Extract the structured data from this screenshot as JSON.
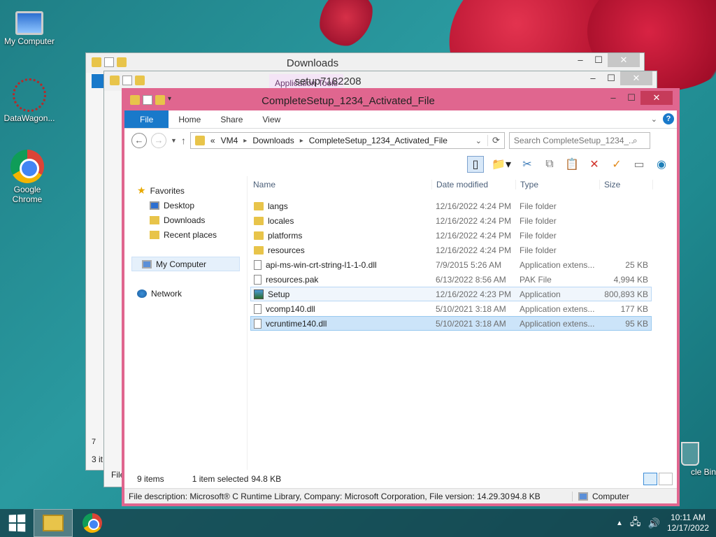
{
  "desktop": {
    "icons": [
      {
        "label": "My Computer"
      },
      {
        "label": "DataWagon..."
      },
      {
        "label": "Google Chrome"
      },
      {
        "label": "cle Bin"
      }
    ]
  },
  "back_windows": [
    {
      "title": "Downloads",
      "status_count": "3 it",
      "status_fragment": "7",
      "footer": "File"
    },
    {
      "title": "setup7182208",
      "context_tab": "Application Tools"
    }
  ],
  "window": {
    "title": "CompleteSetup_1234_Activated_File",
    "ribbon_tabs": {
      "file": "File",
      "home": "Home",
      "share": "Share",
      "view": "View"
    },
    "address": {
      "prefix": "«",
      "segments": [
        "VM4",
        "Downloads",
        "CompleteSetup_1234_Activated_File"
      ]
    },
    "search_placeholder": "Search CompleteSetup_1234_...",
    "nav": {
      "favorites": "Favorites",
      "desktop": "Desktop",
      "downloads": "Downloads",
      "recent": "Recent places",
      "my_computer": "My Computer",
      "network": "Network"
    },
    "columns": {
      "name": "Name",
      "date": "Date modified",
      "type": "Type",
      "size": "Size"
    },
    "files": [
      {
        "name": "langs",
        "date": "12/16/2022 4:24 PM",
        "type": "File folder",
        "size": ""
      },
      {
        "name": "locales",
        "date": "12/16/2022 4:24 PM",
        "type": "File folder",
        "size": ""
      },
      {
        "name": "platforms",
        "date": "12/16/2022 4:24 PM",
        "type": "File folder",
        "size": ""
      },
      {
        "name": "resources",
        "date": "12/16/2022 4:24 PM",
        "type": "File folder",
        "size": ""
      },
      {
        "name": "api-ms-win-crt-string-l1-1-0.dll",
        "date": "7/9/2015 5:26 AM",
        "type": "Application extens...",
        "size": "25 KB"
      },
      {
        "name": "resources.pak",
        "date": "6/13/2022 8:56 AM",
        "type": "PAK File",
        "size": "4,994 KB"
      },
      {
        "name": "Setup",
        "date": "12/16/2022 4:23 PM",
        "type": "Application",
        "size": "800,893 KB"
      },
      {
        "name": "vcomp140.dll",
        "date": "5/10/2021 3:18 AM",
        "type": "Application extens...",
        "size": "177 KB"
      },
      {
        "name": "vcruntime140.dll",
        "date": "5/10/2021 3:18 AM",
        "type": "Application extens...",
        "size": "95 KB"
      }
    ],
    "status": {
      "items": "9 items",
      "selected": "1 item selected",
      "selected_size": "94.8 KB"
    },
    "details": {
      "description": "File description: Microsoft® C Runtime Library, Company: Microsoft Corporation, File version: 14.29.30",
      "size": "94.8 KB",
      "location": "Computer"
    },
    "accent_color": "#e0668f"
  },
  "taskbar": {
    "time": "10:11 AM",
    "date": "12/17/2022"
  }
}
